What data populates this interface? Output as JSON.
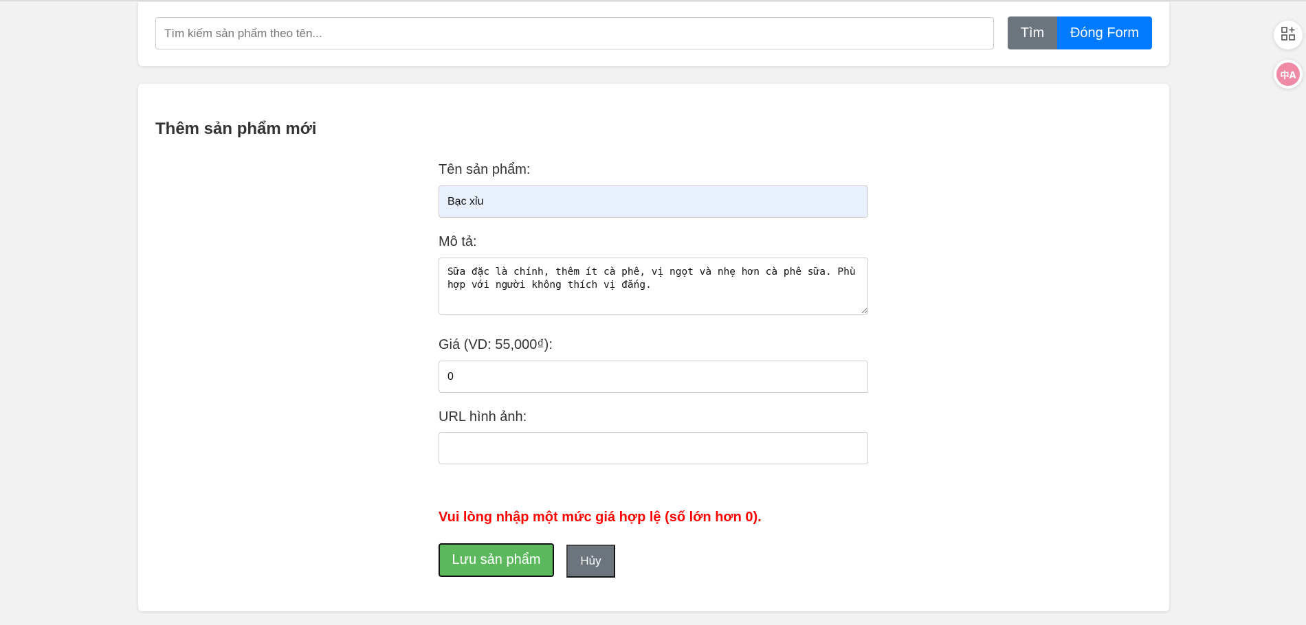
{
  "search": {
    "placeholder": "Tìm kiếm sản phẩm theo tên...",
    "value": "",
    "search_label": "Tìm",
    "close_form_label": "Đóng Form"
  },
  "form": {
    "title": "Thêm sản phẩm mới",
    "name_label": "Tên sản phẩm:",
    "name_value": "Bạc xỉu",
    "description_label": "Mô tả:",
    "description_value": "Sữa đặc là chính, thêm ít cà phê, vị ngọt và nhẹ hơn cà phê sữa. Phù hợp với người không thích vị đắng.",
    "price_label": "Giá (VD: 55,000₫):",
    "price_value": "0",
    "image_url_label": "URL hình ảnh:",
    "image_url_value": "",
    "error_message": "Vui lòng nhập một mức giá hợp lệ (số lớn hơn 0).",
    "save_label": "Lưu sản phẩm",
    "cancel_label": "Hủy"
  },
  "side_tools": {
    "apps_icon": "apps-add-icon",
    "translate_icon": "translate-icon",
    "translate_glyph": "中A",
    "translate_color": "#ee8aa6"
  },
  "colors": {
    "search_button": "#6c757d",
    "close_form_button": "#007bff",
    "save_button": "#5cb85c",
    "error_text": "#ff0000"
  }
}
